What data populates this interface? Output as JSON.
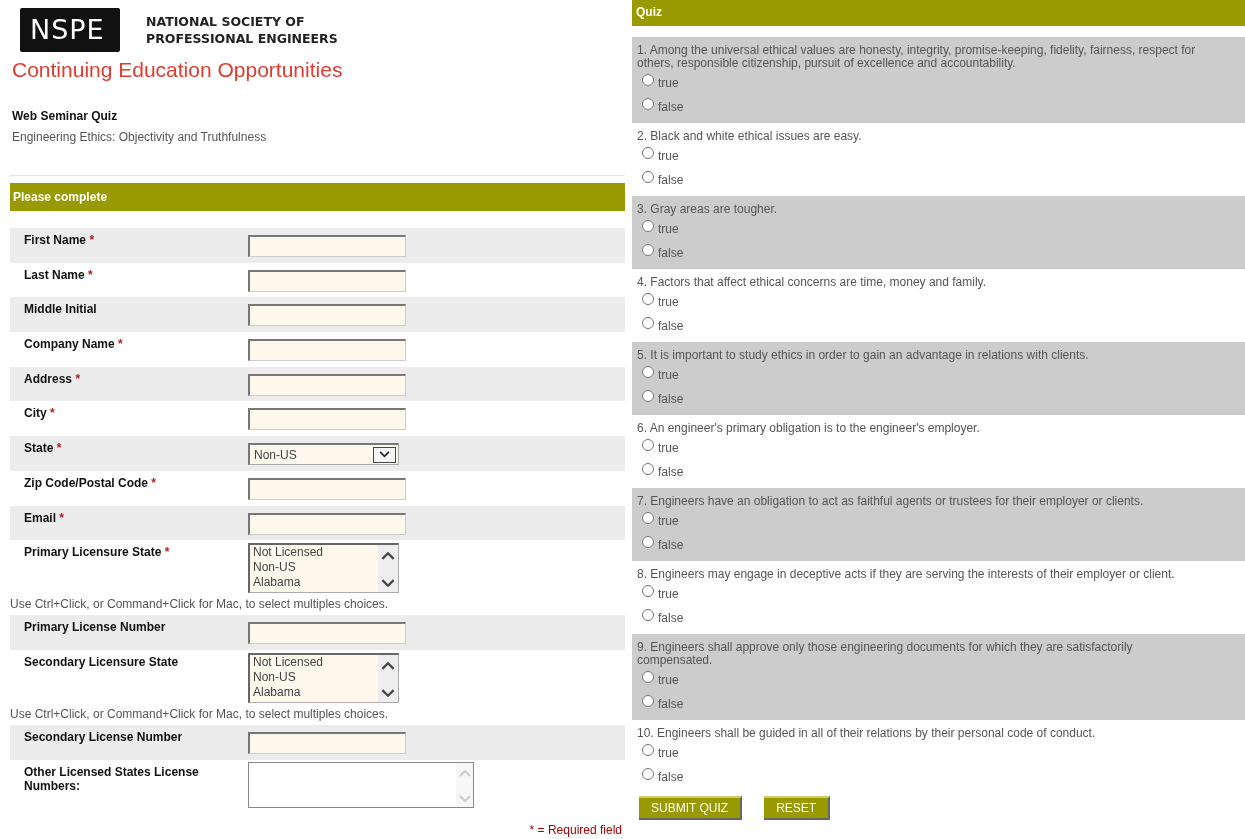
{
  "header": {
    "logo_text": "NSPE",
    "society_name": [
      "NATIONAL SOCIETY OF",
      "PROFESSIONAL ENGINEERS"
    ],
    "title": "Continuing Education Opportunities",
    "quiz_name": "Web Seminar Quiz",
    "course": "Engineering Ethics: Objectivity and Truthfulness"
  },
  "form": {
    "heading": "Please complete",
    "fields": [
      {
        "kind": "text",
        "label": "First Name",
        "required": true
      },
      {
        "kind": "text",
        "label": "Last Name",
        "required": true
      },
      {
        "kind": "text",
        "label": "Middle Initial",
        "required": false
      },
      {
        "kind": "text",
        "label": "Company Name",
        "required": true
      },
      {
        "kind": "text",
        "label": "Address",
        "required": true
      },
      {
        "kind": "text",
        "label": "City",
        "required": true
      },
      {
        "kind": "select",
        "label": "State",
        "required": true,
        "value": "Non-US"
      },
      {
        "kind": "text",
        "label": "Zip Code/Postal Code",
        "required": true
      },
      {
        "kind": "text",
        "label": "Email",
        "required": true
      },
      {
        "kind": "listbox",
        "label": "Primary Licensure State",
        "required": true,
        "options": [
          "Not Licensed",
          "Non-US",
          "Alabama"
        ],
        "hint": "Use Ctrl+Click, or Command+Click for Mac, to select multiples choices."
      },
      {
        "kind": "text",
        "label": "Primary License Number",
        "required": false
      },
      {
        "kind": "listbox",
        "label": "Secondary Licensure State",
        "required": false,
        "options": [
          "Not Licensed",
          "Non-US",
          "Alabama"
        ],
        "hint": "Use Ctrl+Click, or Command+Click for Mac, to select multiples choices."
      },
      {
        "kind": "text",
        "label": "Secondary License Number",
        "required": false
      },
      {
        "kind": "textarea",
        "label": "Other Licensed States License Numbers:",
        "required": false
      }
    ],
    "required_mark": "*",
    "required_note": "* = Required field"
  },
  "quiz": {
    "heading": "Quiz",
    "questions": [
      {
        "text": "1. Among the universal ethical values are honesty, integrity, promise-keeping, fidelity, fairness, respect for others, responsible citizenship, pursuit of excellence and accountability.",
        "options": [
          {
            "label": "true",
            "selected": false
          },
          {
            "label": "false",
            "selected": false
          }
        ]
      },
      {
        "text": "2. Black and white ethical issues are easy.",
        "options": [
          {
            "label": "true",
            "selected": false
          },
          {
            "label": "false",
            "selected": false
          }
        ]
      },
      {
        "text": "3. Gray areas are tougher.",
        "options": [
          {
            "label": "true",
            "selected": false
          },
          {
            "label": "false",
            "selected": false
          }
        ]
      },
      {
        "text": "4. Factors that affect ethical concerns are time, money and family.",
        "options": [
          {
            "label": "true",
            "selected": false
          },
          {
            "label": "false",
            "selected": false
          }
        ]
      },
      {
        "text": "5. It is important to study ethics in order to gain an advantage in relations with clients.",
        "options": [
          {
            "label": "true",
            "selected": false
          },
          {
            "label": "false",
            "selected": false
          }
        ]
      },
      {
        "text": "6. An engineer's primary obligation is to the engineer's employer.",
        "options": [
          {
            "label": "true",
            "selected": false
          },
          {
            "label": "false",
            "selected": false
          }
        ]
      },
      {
        "text": "7. Engineers have an obligation to act as faithful agents or trustees for their employer or clients.",
        "options": [
          {
            "label": "true",
            "selected": false
          },
          {
            "label": "false",
            "selected": false
          }
        ]
      },
      {
        "text": "8. Engineers may engage in deceptive acts if they are serving the interests of their employer or client.",
        "options": [
          {
            "label": "true",
            "selected": false
          },
          {
            "label": "false",
            "selected": false
          }
        ]
      },
      {
        "text": "9. Engineers shall approve only those engineering documents for which they are satisfactorily compensated.",
        "options": [
          {
            "label": "true",
            "selected": false
          },
          {
            "label": "false",
            "selected": false
          }
        ]
      },
      {
        "text": "10. Engineers shall be guided in all of their relations by their personal code of conduct.",
        "options": [
          {
            "label": "true",
            "selected": false
          },
          {
            "label": "false",
            "selected": false
          }
        ]
      }
    ],
    "buttons": [
      "SUBMIT QUIZ",
      "RESET"
    ]
  }
}
